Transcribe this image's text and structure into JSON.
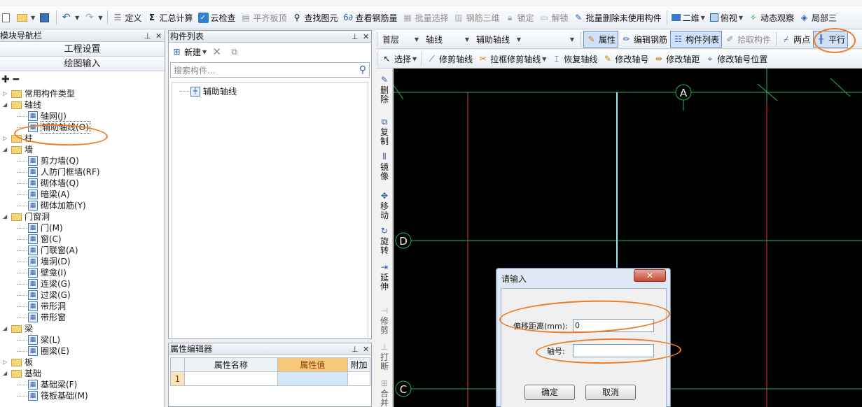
{
  "colors": {
    "accent_highlight": "#cfe0f7",
    "canvas_bg": "#000000",
    "grid_red": "#e8323c",
    "grid_green": "#1fb45a",
    "aux_axis": "#9ee6f0",
    "annotation": "#f07a23",
    "dialog_close": "#c54a36"
  },
  "toolbar1": {
    "items": [
      {
        "label": "定义",
        "icon": "define-icon"
      },
      {
        "label": "汇总计算",
        "icon": "sigma-icon"
      },
      {
        "label": "云检查",
        "icon": "cloud-check-icon"
      },
      {
        "label": "平齐板顶",
        "icon": "align-slab-icon"
      },
      {
        "label": "查找图元",
        "icon": "find-icon"
      },
      {
        "label": "查看钢筋量",
        "icon": "rebar-qty-icon"
      },
      {
        "label": "批量选择",
        "icon": "batch-select-icon"
      },
      {
        "label": "钢筋三维",
        "icon": "rebar-3d-icon"
      },
      {
        "label": "锁定",
        "icon": "lock-icon"
      },
      {
        "label": "解锁",
        "icon": "unlock-icon"
      },
      {
        "label": "批量删除未使用构件",
        "icon": "batch-delete-icon"
      },
      {
        "label": "二维",
        "icon": "2d-icon"
      },
      {
        "label": "俯视",
        "icon": "top-view-icon"
      },
      {
        "label": "动态观察",
        "icon": "orbit-icon"
      },
      {
        "label": "局部三",
        "icon": "local-3d-icon"
      }
    ]
  },
  "nav": {
    "title": "模块导航栏",
    "btn_project": "工程设置",
    "btn_draw": "绘图输入",
    "tools": "✚ ━",
    "tree": [
      {
        "label": "常用构件类型",
        "level": 0,
        "type": "folder",
        "expanded": false
      },
      {
        "label": "轴线",
        "level": 0,
        "type": "folder",
        "expanded": true
      },
      {
        "label": "轴网(J)",
        "level": 1,
        "type": "item"
      },
      {
        "label": "辅助轴线(O)",
        "level": 1,
        "type": "item",
        "selected": true
      },
      {
        "label": "柱",
        "level": 0,
        "type": "folder",
        "expanded": false
      },
      {
        "label": "墙",
        "level": 0,
        "type": "folder",
        "expanded": true
      },
      {
        "label": "剪力墙(Q)",
        "level": 1,
        "type": "item"
      },
      {
        "label": "人防门框墙(RF)",
        "level": 1,
        "type": "item"
      },
      {
        "label": "砌体墙(Q)",
        "level": 1,
        "type": "item"
      },
      {
        "label": "暗梁(A)",
        "level": 1,
        "type": "item"
      },
      {
        "label": "砌体加筋(Y)",
        "level": 1,
        "type": "item"
      },
      {
        "label": "门窗洞",
        "level": 0,
        "type": "folder",
        "expanded": true
      },
      {
        "label": "门(M)",
        "level": 1,
        "type": "item"
      },
      {
        "label": "窗(C)",
        "level": 1,
        "type": "item"
      },
      {
        "label": "门联窗(A)",
        "level": 1,
        "type": "item"
      },
      {
        "label": "墙洞(D)",
        "level": 1,
        "type": "item"
      },
      {
        "label": "壁龛(I)",
        "level": 1,
        "type": "item"
      },
      {
        "label": "连梁(G)",
        "level": 1,
        "type": "item"
      },
      {
        "label": "过梁(G)",
        "level": 1,
        "type": "item"
      },
      {
        "label": "带形洞",
        "level": 1,
        "type": "item"
      },
      {
        "label": "带形窗",
        "level": 1,
        "type": "item"
      },
      {
        "label": "梁",
        "level": 0,
        "type": "folder",
        "expanded": true
      },
      {
        "label": "梁(L)",
        "level": 1,
        "type": "item"
      },
      {
        "label": "圈梁(E)",
        "level": 1,
        "type": "item"
      },
      {
        "label": "板",
        "level": 0,
        "type": "folder",
        "expanded": false
      },
      {
        "label": "基础",
        "level": 0,
        "type": "folder",
        "expanded": true
      },
      {
        "label": "基础梁(F)",
        "level": 1,
        "type": "item"
      },
      {
        "label": "筏板基础(M)",
        "level": 1,
        "type": "item"
      }
    ]
  },
  "complist": {
    "title": "构件列表",
    "new_label": "新建",
    "search_placeholder": "搜索构件...",
    "items": [
      "辅助轴线"
    ]
  },
  "propedit": {
    "title": "属性编辑器",
    "col_name": "属性名称",
    "col_value": "属性值",
    "col_extra": "附加",
    "row_index": "1"
  },
  "tbar2": {
    "floor": "首层",
    "category": "轴线",
    "component": "辅助轴线",
    "property": "属性",
    "edit_rebar": "编辑钢筋",
    "comp_list": "构件列表",
    "pick": "拾取构件",
    "two_point": "两点",
    "parallel": "平行"
  },
  "tbar3": {
    "select": "选择",
    "trim": "修剪轴线",
    "box_trim": "拉框修剪轴线",
    "restore": "恢复轴线",
    "edit_label": "修改轴号",
    "edit_dist": "修改轴距",
    "edit_pos": "修改轴号位置"
  },
  "vbar": {
    "items": [
      {
        "label": "删除",
        "icon": "brush-icon"
      },
      {
        "label": "复制",
        "icon": "copy-icon"
      },
      {
        "label": "镜像",
        "icon": "mirror-icon"
      },
      {
        "label": "移动",
        "icon": "move-icon"
      },
      {
        "label": "旋转",
        "icon": "rotate-icon"
      },
      {
        "label": "延伸",
        "icon": "extend-icon"
      },
      {
        "label": "修剪",
        "icon": "trim-icon"
      },
      {
        "label": "打断",
        "icon": "break-icon"
      },
      {
        "label": "合并",
        "icon": "merge-icon"
      }
    ]
  },
  "canvas": {
    "axis_top": "A",
    "axis_left1": "D",
    "axis_left2": "C"
  },
  "dialog": {
    "title": "请输入",
    "close": "✕",
    "offset_label": "偏移距离(mm):",
    "offset_value": "0",
    "axis_label": "轴号:",
    "axis_value": "",
    "ok": "确定",
    "cancel": "取消"
  }
}
